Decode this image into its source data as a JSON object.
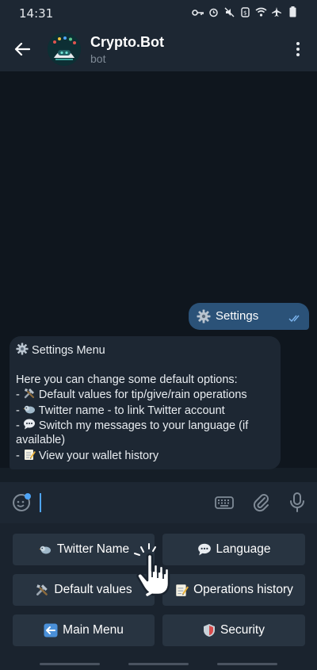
{
  "status": {
    "time": "14:31"
  },
  "header": {
    "title": "Crypto.Bot",
    "subtitle": "bot"
  },
  "messages": {
    "outgoing": {
      "icon": "gear-icon",
      "text": "Settings"
    },
    "incoming": {
      "title_icon": "gear-icon",
      "title": "Settings Menu",
      "intro": "Here you can change some default options:",
      "items": [
        {
          "prefix": "- ",
          "icon": "tools-icon",
          "text": "Default values for tip/give/rain operations"
        },
        {
          "prefix": "- ",
          "icon": "bird-icon",
          "text": "Twitter name - to link Twitter account"
        },
        {
          "prefix": "- ",
          "icon": "speech-bubble-icon",
          "text": "Switch my messages to your language (if"
        },
        {
          "prefix": "",
          "icon": "",
          "text": "available)"
        },
        {
          "prefix": "- ",
          "icon": "memo-icon",
          "text": "View your wallet history"
        }
      ]
    }
  },
  "keyboard": {
    "buttons": [
      {
        "icon": "bird-icon",
        "label": "Twitter Name"
      },
      {
        "icon": "speech-bubble-icon",
        "label": "Language"
      },
      {
        "icon": "tools-icon",
        "label": "Default values"
      },
      {
        "icon": "memo-icon",
        "label": "Operations history"
      },
      {
        "icon": "back-arrow-icon",
        "label": "Main Menu"
      },
      {
        "icon": "shield-icon",
        "label": "Security"
      }
    ]
  },
  "colors": {
    "header_bg": "#1d2733",
    "chat_bg": "#0f161e",
    "outgoing_bubble": "#2b5278",
    "incoming_bubble": "#1d2733",
    "keyboard_button": "#283441",
    "accent": "#4ea4f6"
  }
}
